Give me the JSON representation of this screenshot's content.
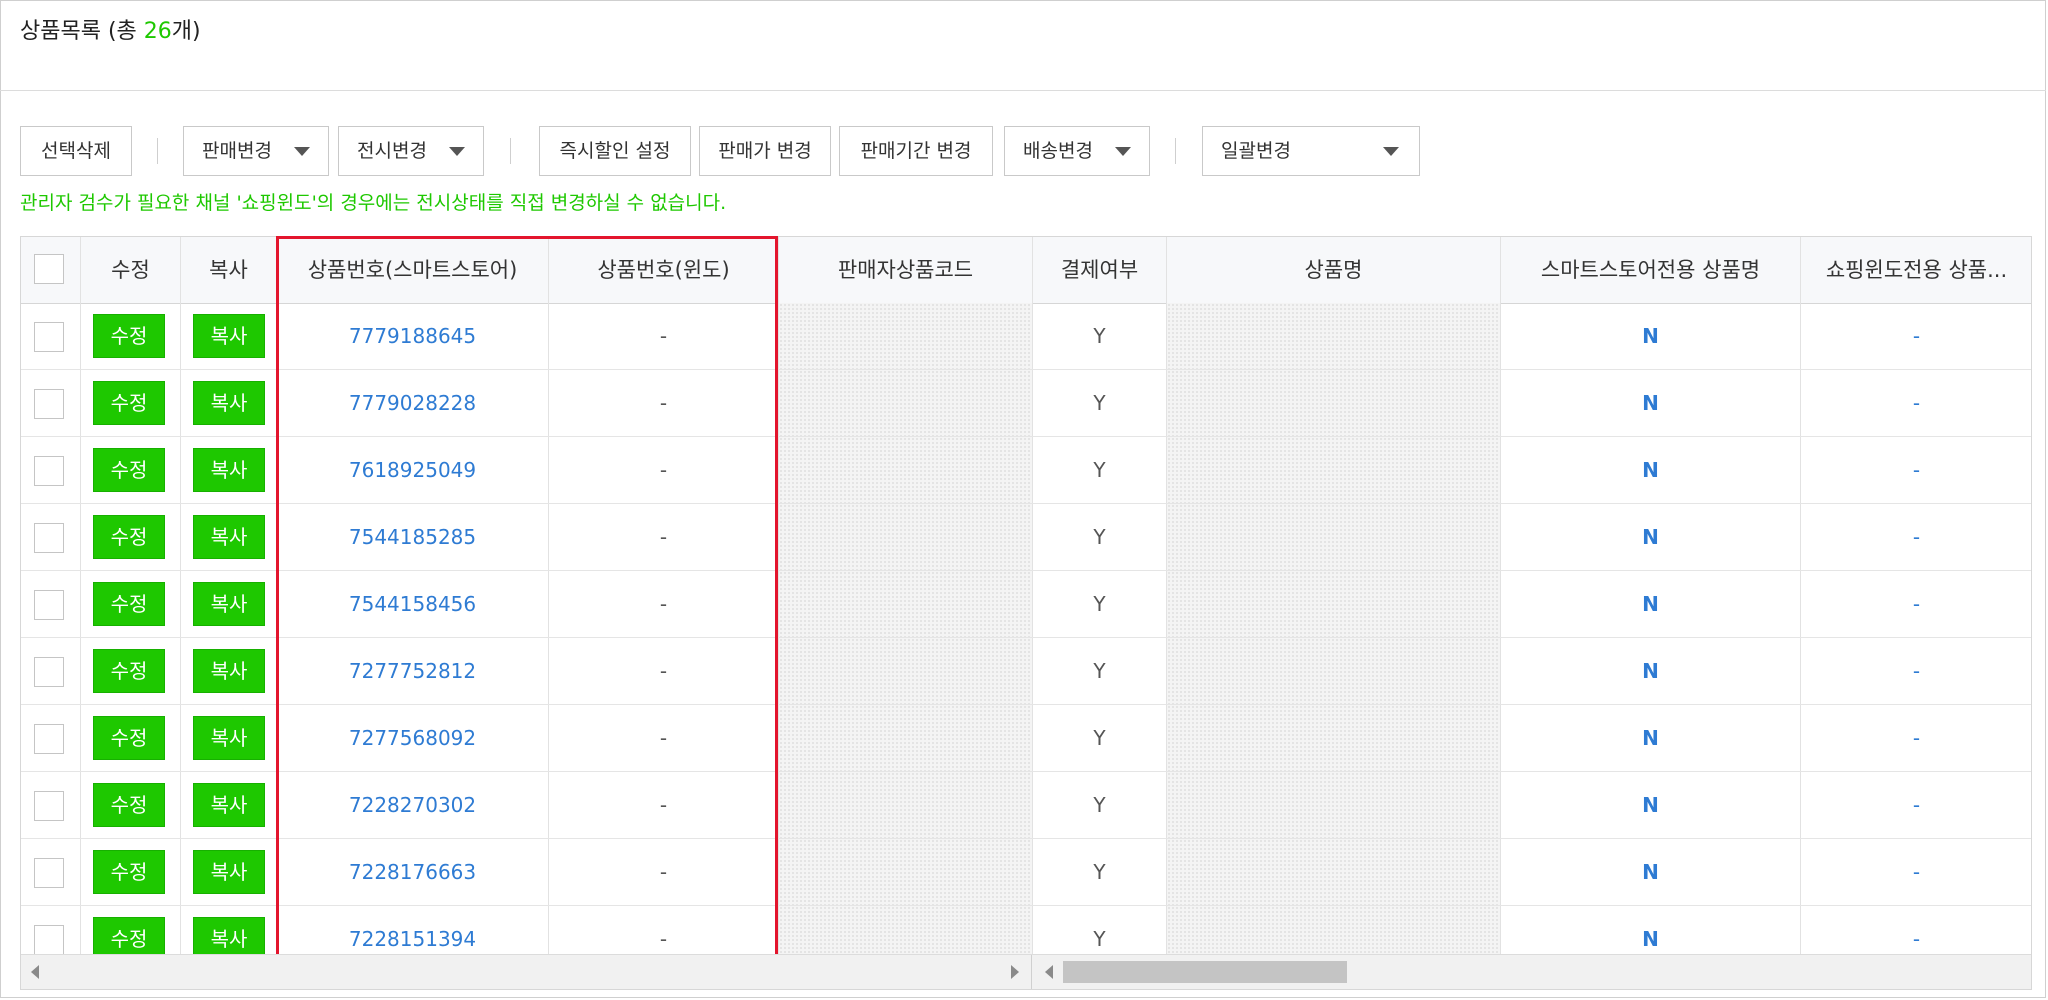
{
  "header": {
    "title_prefix": "상품목록 (총 ",
    "count": "26",
    "title_suffix": "개)"
  },
  "toolbar": {
    "delete_label": "선택삭제",
    "sale_change_label": "판매변경",
    "display_change_label": "전시변경",
    "instant_discount_label": "즉시할인 설정",
    "price_change_label": "판매가 변경",
    "period_change_label": "판매기간 변경",
    "delivery_change_label": "배송변경",
    "bulk_change_label": "일괄변경"
  },
  "notice": "관리자 검수가 필요한 채널 '쇼핑윈도'의 경우에는 전시상태를 직접 변경하실 수 없습니다.",
  "table": {
    "columns": {
      "edit": "수정",
      "copy": "복사",
      "product_no_smartstore": "상품번호(스마트스토어)",
      "product_no_window": "상품번호(윈도)",
      "seller_code": "판매자상품코드",
      "payment": "결제여부",
      "product_name": "상품명",
      "smartstore_name": "스마트스토어전용 상품명",
      "window_name": "쇼핑윈도전용 상품..."
    },
    "edit_label": "수정",
    "copy_label": "복사",
    "rows": [
      {
        "smartstore_no": "7779188645",
        "window_no": "-",
        "payment": "Y",
        "smartstore_name": "N",
        "window_name": "-"
      },
      {
        "smartstore_no": "7779028228",
        "window_no": "-",
        "payment": "Y",
        "smartstore_name": "N",
        "window_name": "-"
      },
      {
        "smartstore_no": "7618925049",
        "window_no": "-",
        "payment": "Y",
        "smartstore_name": "N",
        "window_name": "-"
      },
      {
        "smartstore_no": "7544185285",
        "window_no": "-",
        "payment": "Y",
        "smartstore_name": "N",
        "window_name": "-"
      },
      {
        "smartstore_no": "7544158456",
        "window_no": "-",
        "payment": "Y",
        "smartstore_name": "N",
        "window_name": "-"
      },
      {
        "smartstore_no": "7277752812",
        "window_no": "-",
        "payment": "Y",
        "smartstore_name": "N",
        "window_name": "-"
      },
      {
        "smartstore_no": "7277568092",
        "window_no": "-",
        "payment": "Y",
        "smartstore_name": "N",
        "window_name": "-"
      },
      {
        "smartstore_no": "7228270302",
        "window_no": "-",
        "payment": "Y",
        "smartstore_name": "N",
        "window_name": "-"
      },
      {
        "smartstore_no": "7228176663",
        "window_no": "-",
        "payment": "Y",
        "smartstore_name": "N",
        "window_name": "-"
      },
      {
        "smartstore_no": "7228151394",
        "window_no": "-",
        "payment": "Y",
        "smartstore_name": "N",
        "window_name": "-"
      }
    ]
  },
  "colors": {
    "accent_green": "#1ec800",
    "link_blue": "#2e7bd3",
    "highlight_red": "#e3152d"
  }
}
